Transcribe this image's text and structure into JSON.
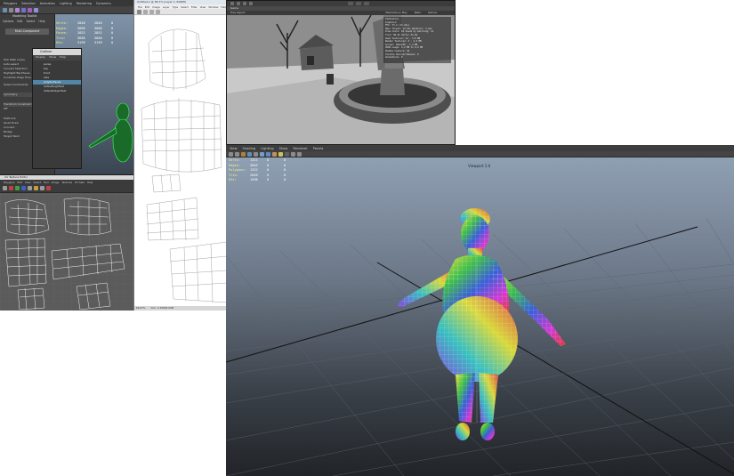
{
  "maya_main": {
    "top_menu": [
      "Polygons",
      "Selection",
      "Animation",
      "Lighting",
      "Rendering",
      "Dynamics"
    ],
    "panel_title": "Modeling Toolkit",
    "panel_menu": [
      "Options",
      "Edit",
      "Select",
      "Help"
    ],
    "panel_button": "Multi-Component",
    "panel_items": [
      "Pick Walk Loops",
      "Auto-select",
      "Convert Selection",
      "Highlight Backfaces",
      "Constrain Edge Flow",
      "Select Constraints",
      "Symmetry",
      "Transform Constraint",
      "Off",
      "Multi-Cut",
      "Quad Draw",
      "Connect",
      "Bridge",
      "Target Weld"
    ],
    "stats": [
      {
        "label": "Verts:",
        "v1": "2840",
        "v2": "2840",
        "v3": "0"
      },
      {
        "label": "Edges:",
        "v1": "5686",
        "v2": "5686",
        "v3": "0"
      },
      {
        "label": "Faces:",
        "v1": "2852",
        "v2": "2852",
        "v3": "0"
      },
      {
        "label": "Tris:",
        "v1": "5680",
        "v2": "5680",
        "v3": "0"
      },
      {
        "label": "UVs:",
        "v1": "3199",
        "v2": "3199",
        "v3": "0"
      }
    ]
  },
  "outliner": {
    "title": "Outliner",
    "menu": [
      "Display",
      "Show",
      "Help"
    ],
    "items": [
      "persp",
      "top",
      "front",
      "side",
      "polySurface1",
      "defaultLightSet",
      "defaultObjectSet"
    ]
  },
  "uv_editor": {
    "title": "UV Texture Editor",
    "menu": [
      "Polygons",
      "Edit",
      "View",
      "Select",
      "Tool",
      "Image",
      "Textures",
      "UV Sets",
      "Help"
    ]
  },
  "photoshop": {
    "title": "Untitled-1 @ 66.7% (Layer 1, RGB/8)",
    "menu": [
      "File",
      "Edit",
      "Image",
      "Layer",
      "Type",
      "Select",
      "Filter",
      "View",
      "Window",
      "Help"
    ],
    "status_zoom": "66.67%",
    "status_doc": "Doc: 2.25M/6.00M"
  },
  "game_viewport": {
    "title": "Game",
    "toolbar": [
      "Free Aspect",
      "Maximize on Play",
      "Stats",
      "Gizmos"
    ],
    "stats_title": "Statistics",
    "stats_lines": [
      "Graphics:",
      "FPS: 73.2 (13.7ms)",
      "Main Thread: 13.7ms  Renderer: 4.1ms",
      "Draw Calls: 64  Saved by batching: 12",
      "Tris: 58.4k  Verts: 41.9k",
      "Used Textures: 14 - 3.8 MB",
      "Render Textures: 3 - 2.3 MB",
      "Screen: 502x236 - 1.4 MB",
      "VRAM usage: 6.2 MB to 9.8 MB",
      "Shadow Casters: 19",
      "Visible Skinned Meshes: 0",
      "Animations: 0"
    ]
  },
  "viewport": {
    "menu": [
      "View",
      "Shading",
      "Lighting",
      "Show",
      "Renderer",
      "Panels"
    ],
    "label": "Viewport 2.0",
    "hud": [
      {
        "label": "Verts:",
        "a": "1321",
        "b": "0",
        "c": "0"
      },
      {
        "label": "Edges:",
        "a": "2645",
        "b": "0",
        "c": "0"
      },
      {
        "label": "Polygons:",
        "a": "1322",
        "b": "0",
        "c": "0"
      },
      {
        "label": "Tris:",
        "a": "2640",
        "b": "0",
        "c": "0"
      },
      {
        "label": "UVs:",
        "a": "1598",
        "b": "0",
        "c": "0"
      }
    ]
  },
  "colors": {
    "maya_bg": "#444444",
    "viewport_top": "#93a4b8",
    "viewport_bottom": "#212428",
    "hud_label": "#f2f28a",
    "selection": "#5285a6",
    "wire_green": "#3cff5a"
  }
}
